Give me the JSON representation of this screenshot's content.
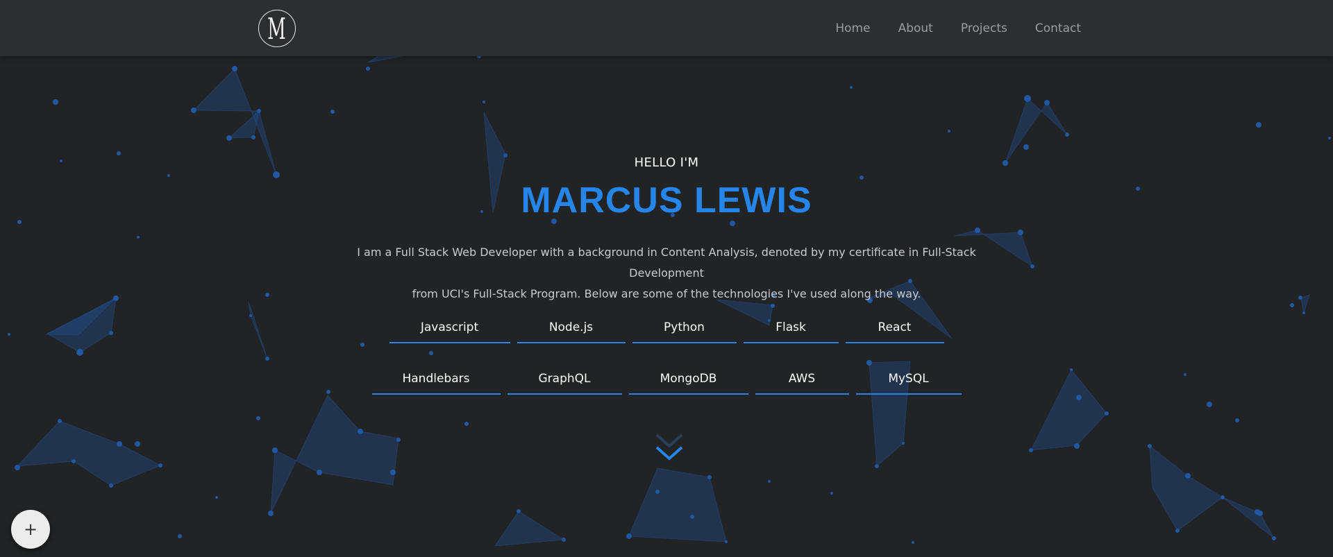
{
  "colors": {
    "accent": "#2585e8",
    "background": "#222324",
    "navbar": "#2d2e2f",
    "network": "#1e4a86"
  },
  "navbar": {
    "logo_letter": "M",
    "links": [
      "Home",
      "About",
      "Projects",
      "Contact"
    ]
  },
  "hero": {
    "greeting": "HELLO I'M",
    "name": "MARCUS LEWIS",
    "bio_line1": "I am a Full Stack Web Developer with a background in Content Analysis, denoted by my certificate in Full-Stack Development",
    "bio_line2": "from UCI's Full-Stack Program. Below are some of the technologies I've used along the way.",
    "technologies_row1": [
      "Javascript",
      "Node.js",
      "Python",
      "Flask",
      "React"
    ],
    "technologies_row2": [
      "Handlebars",
      "GraphQL",
      "MongoDB",
      "AWS",
      "MySQL"
    ],
    "scroll_icon": "double-chevron-down-icon"
  },
  "fab": {
    "symbol": "+",
    "icon": "plus-icon"
  }
}
